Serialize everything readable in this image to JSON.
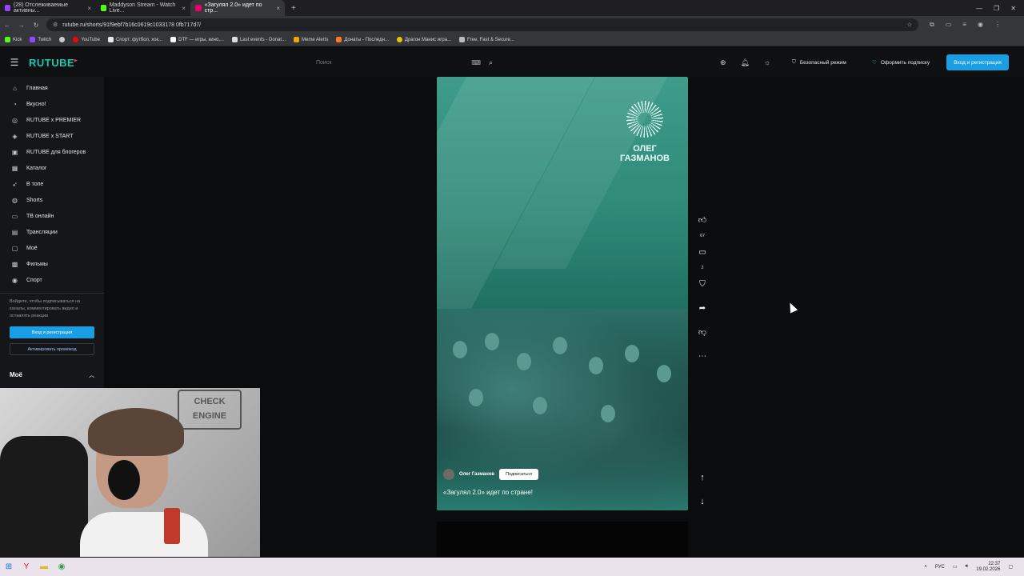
{
  "browser": {
    "tabs": [
      {
        "title": "(28) Отслеживаемые активны...",
        "color": "#9147ff",
        "active": false
      },
      {
        "title": "Maddyson Stream - Watch Live...",
        "color": "#53fc18",
        "active": false
      },
      {
        "title": "«Загулял 2.0» идет по стр...",
        "color": "#e6006a",
        "active": true
      }
    ],
    "new_tab": "+",
    "url": "rutube.ru/shorts/91f9ebf7b16c0619c1033178 0fb717d7/",
    "bookmarks": [
      {
        "label": "Kick",
        "color": "#53fc18"
      },
      {
        "label": "Twitch",
        "color": "#9147ff"
      },
      {
        "label": "",
        "color": "#cccccc"
      },
      {
        "label": "YouTube",
        "color": "#ff0000"
      },
      {
        "label": "Спорт: футбол, хок...",
        "color": "#e8e8e8"
      },
      {
        "label": "DTF — игры, кино,...",
        "color": "#ffffff"
      },
      {
        "label": "Last events - Donat...",
        "color": "#dddddd"
      },
      {
        "label": "Meme Alerts",
        "color": "#f4a300"
      },
      {
        "label": "Донаты - Последн...",
        "color": "#f47a20"
      },
      {
        "label": "Драгон Манис игра...",
        "color": "#e9c200"
      },
      {
        "label": "Free, Fast & Secure...",
        "color": "#bbbbbb"
      }
    ]
  },
  "header": {
    "logo": "RUTUBE",
    "search_placeholder": "Поиск",
    "safe_mode": "Безопасный режим",
    "subscribe": "Оформить подписку",
    "login": "Вход и регистрация"
  },
  "sidebar": {
    "items": [
      {
        "label": "Главная",
        "icon": "home-icon",
        "glyph": "⌂"
      },
      {
        "label": "Вкусно!",
        "icon": "food-icon",
        "glyph": "◔"
      },
      {
        "label": "RUTUBE x PREMIER",
        "icon": "premier-icon",
        "glyph": "◎"
      },
      {
        "label": "RUTUBE x START",
        "icon": "start-icon",
        "glyph": "◈"
      },
      {
        "label": "RUTUBE для блогеров",
        "icon": "blogger-icon",
        "glyph": "▣"
      },
      {
        "label": "Каталог",
        "icon": "catalog-icon",
        "glyph": "▦"
      },
      {
        "label": "В топе",
        "icon": "rocket-icon",
        "glyph": "➶"
      },
      {
        "label": "Shorts",
        "icon": "shorts-icon",
        "glyph": "◍"
      },
      {
        "label": "ТВ онлайн",
        "icon": "tv-icon",
        "glyph": "▭"
      },
      {
        "label": "Трансляции",
        "icon": "broadcast-icon",
        "glyph": "▤"
      },
      {
        "label": "Моё",
        "icon": "folder-icon",
        "glyph": "▢"
      },
      {
        "label": "Фильмы",
        "icon": "film-icon",
        "glyph": "▩"
      },
      {
        "label": "Спорт",
        "icon": "sport-icon",
        "glyph": "◉"
      }
    ],
    "note": "Войдите, чтобы подписываться на каналы, комментировать видео и оставлять реакции",
    "login_button": "Вход и регистрация",
    "promo_button": "Активировать промокод",
    "section": "Моё"
  },
  "video": {
    "brand": "ОЛЕГ ГАЗМАНОВ",
    "author": "Олег Газманов",
    "subscribe_button": "Подписаться",
    "caption": "«Загулял 2.0» идет по стране!",
    "likes": "67",
    "comments": "2"
  },
  "taskbar": {
    "lang": "РУС",
    "time": "22:37",
    "date": "19.02.2026"
  }
}
